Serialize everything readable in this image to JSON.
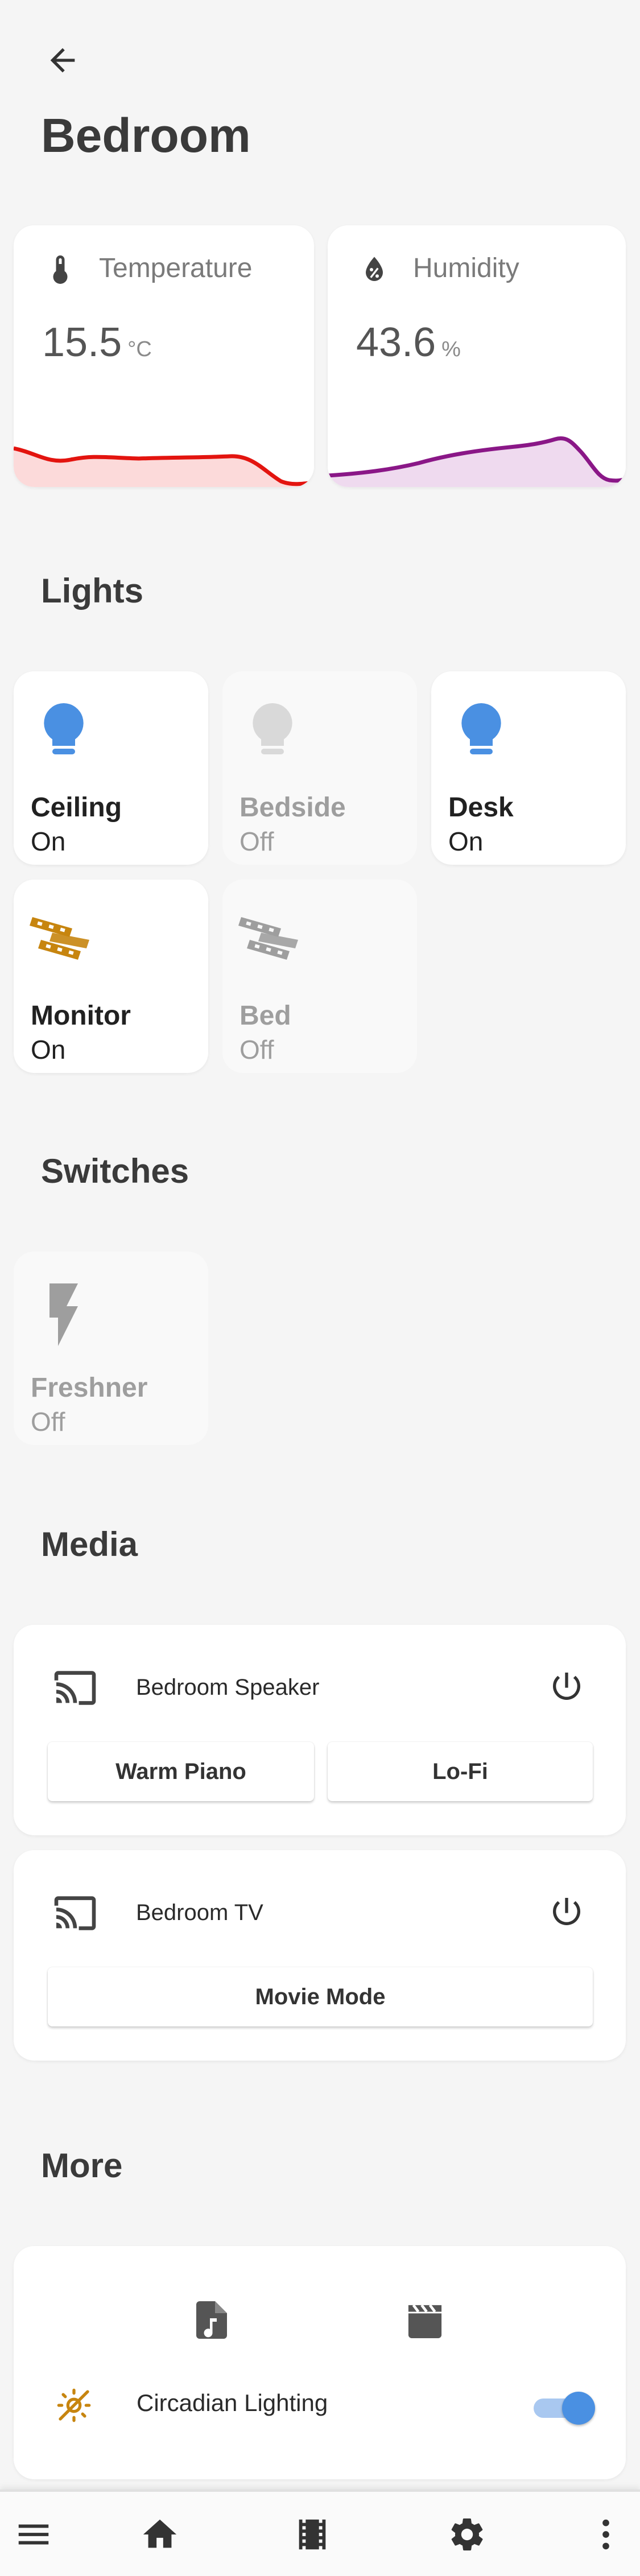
{
  "header": {
    "title": "Bedroom",
    "back_icon": "arrow-left-icon"
  },
  "sensors": [
    {
      "name": "Temperature",
      "value": "15.5",
      "unit": "°C",
      "icon": "thermometer-icon",
      "color": "#e3140f",
      "fill": "#fcdada"
    },
    {
      "name": "Humidity",
      "value": "43.6",
      "unit": "%",
      "icon": "water-percent-icon",
      "color": "#8a1787",
      "fill": "#efdaef"
    }
  ],
  "sections": {
    "lights": "Lights",
    "switches": "Switches",
    "media": "Media",
    "more": "More"
  },
  "lights": [
    {
      "name": "Ceiling",
      "state": "On",
      "icon": "lightbulb-icon"
    },
    {
      "name": "Bedside",
      "state": "Off",
      "icon": "lightbulb-icon"
    },
    {
      "name": "Desk",
      "state": "On",
      "icon": "lightbulb-icon"
    },
    {
      "name": "Monitor",
      "state": "On",
      "icon": "led-strip-icon"
    },
    {
      "name": "Bed",
      "state": "Off",
      "icon": "led-strip-icon"
    }
  ],
  "switches": [
    {
      "name": "Freshner",
      "state": "Off",
      "icon": "flash-icon"
    }
  ],
  "media": [
    {
      "name": "Bedroom Speaker",
      "buttons": [
        "Warm Piano",
        "Lo-Fi"
      ]
    },
    {
      "name": "Bedroom TV",
      "buttons": [
        "Movie Mode"
      ]
    }
  ],
  "more": {
    "icons": [
      "music-file-icon",
      "clapperboard-icon"
    ],
    "circadian_label": "Circadian Lighting",
    "circadian_enabled": true
  },
  "colors": {
    "light_on": "#4a90e2",
    "light_off": "#d9d9d9",
    "strip_on": "#c7850f",
    "strip_off": "#9e9e9e",
    "toggle": "#4a90e2"
  },
  "bottom_nav": [
    "menu-icon",
    "home-icon",
    "film-icon",
    "gear-icon",
    "more-vertical-icon"
  ]
}
